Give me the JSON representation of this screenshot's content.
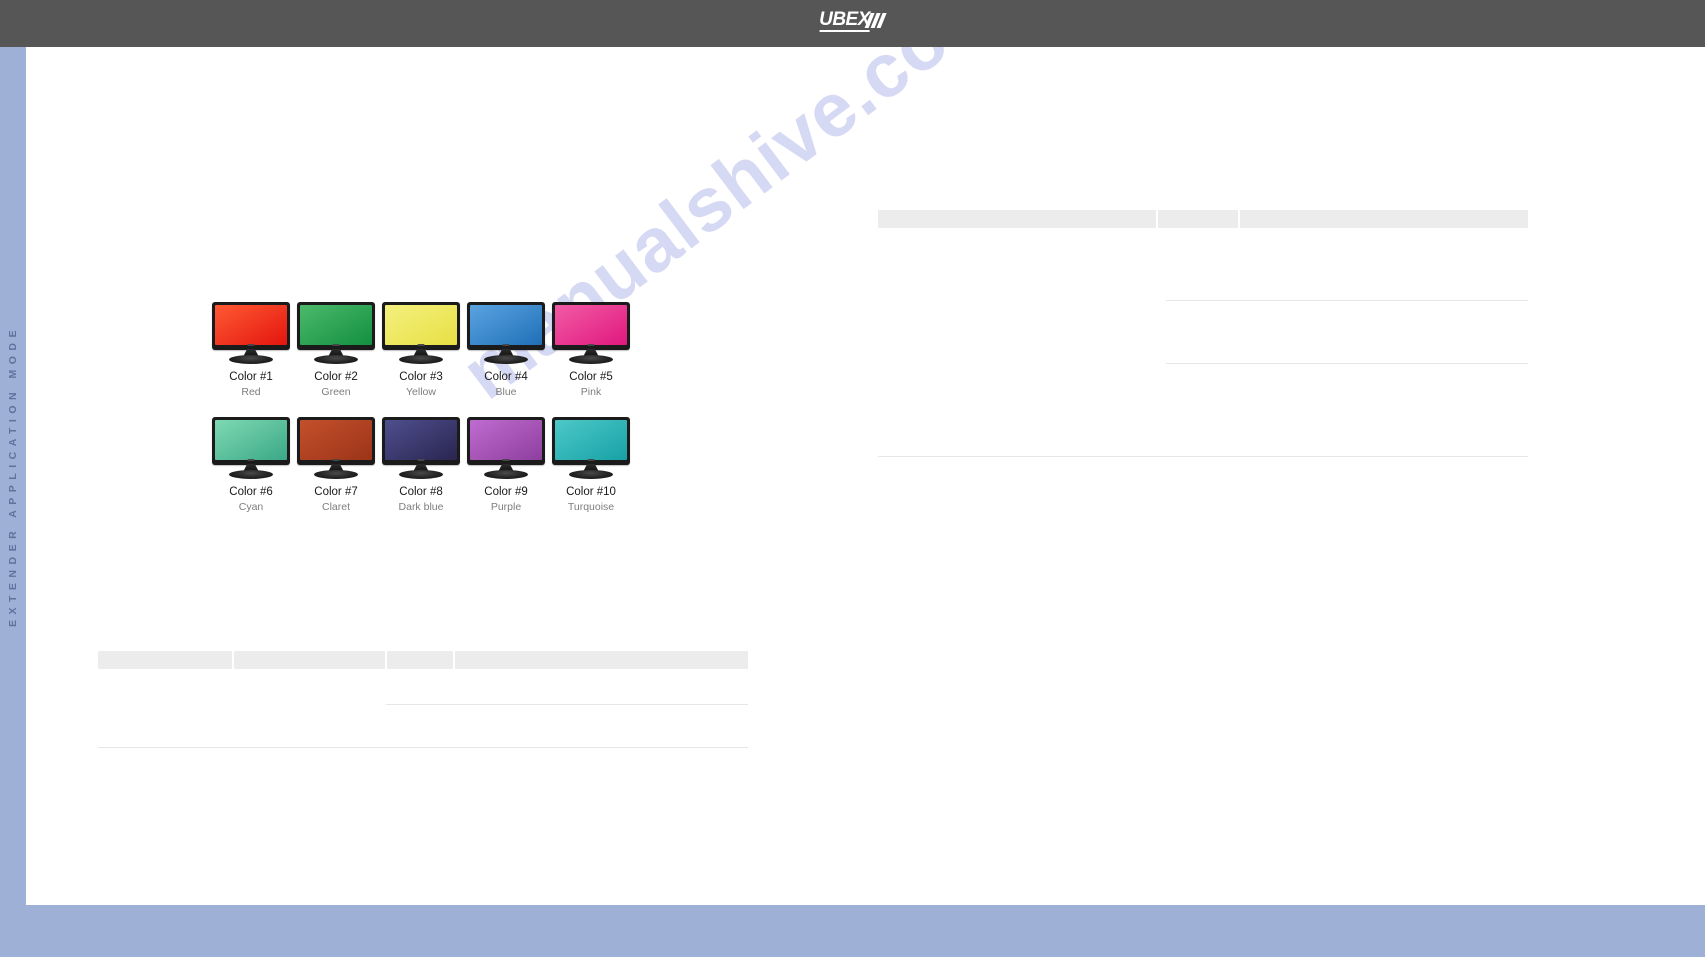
{
  "header": {
    "logo_text": "UBEX",
    "logo_icon": "chevron-stripes-icon",
    "background_color": "#565656"
  },
  "sidebar": {
    "vertical_label": "EXTENDER APPLICATION MODE",
    "background_color": "#9eb0d6",
    "text_color": "#5f729c"
  },
  "watermark": {
    "text": "manualshive.com",
    "color": "#c9cdf0"
  },
  "monitors": {
    "rows": [
      [
        {
          "label": "Color #1",
          "name": "Red",
          "gradient_from": "#ff5a33",
          "gradient_to": "#e3150f"
        },
        {
          "label": "Color #2",
          "name": "Green",
          "gradient_from": "#4cb96a",
          "gradient_to": "#119040"
        },
        {
          "label": "Color #3",
          "name": "Yellow",
          "gradient_from": "#f4f07e",
          "gradient_to": "#e7e044"
        },
        {
          "label": "Color #4",
          "name": "Blue",
          "gradient_from": "#5ba3e0",
          "gradient_to": "#1f6fb8"
        },
        {
          "label": "Color #5",
          "name": "Pink",
          "gradient_from": "#f25ba5",
          "gradient_to": "#e0187e"
        }
      ],
      [
        {
          "label": "Color #6",
          "name": "Cyan",
          "gradient_from": "#7fd9b4",
          "gradient_to": "#3aa886"
        },
        {
          "label": "Color #7",
          "name": "Claret",
          "gradient_from": "#c3502c",
          "gradient_to": "#9c3418"
        },
        {
          "label": "Color #8",
          "name": "Dark blue",
          "gradient_from": "#4e4f8e",
          "gradient_to": "#2a2550"
        },
        {
          "label": "Color #9",
          "name": "Purple",
          "gradient_from": "#c06bd0",
          "gradient_to": "#8e3f9e"
        },
        {
          "label": "Color #10",
          "name": "Turquoise",
          "gradient_from": "#4dc8c8",
          "gradient_to": "#17a2a6"
        }
      ]
    ]
  },
  "tables": {
    "right": {
      "header_cells": [
        "",
        "",
        ""
      ],
      "rule_count": 3
    },
    "bottom_left": {
      "header_cells": [
        "",
        "",
        "",
        ""
      ],
      "rule_count": 3
    }
  }
}
